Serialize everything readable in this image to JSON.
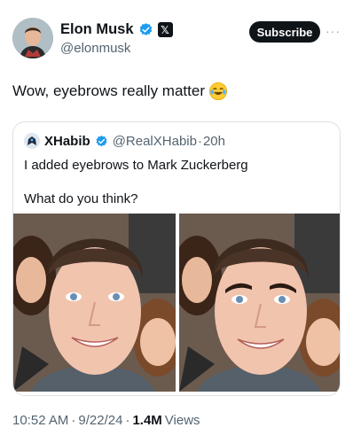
{
  "author": {
    "name": "Elon Musk",
    "handle": "@elonmusk",
    "subscribe_label": "Subscribe",
    "more_label": "···"
  },
  "tweet": {
    "text": "Wow, eyebrows really matter",
    "emoji": "face-with-tears-of-joy"
  },
  "quote": {
    "name": "XHabib",
    "handle": "@RealXHabib",
    "separator": "·",
    "time": "20h",
    "line1": "I added eyebrows to Mark Zuckerberg",
    "line2": "What do you think?",
    "images": [
      "original-photo",
      "edited-photo-with-eyebrows"
    ]
  },
  "meta": {
    "time": "10:52 AM",
    "sep1": "·",
    "date": "9/22/24",
    "sep2": "·",
    "views_count": "1.4M",
    "views_label": "Views"
  },
  "colors": {
    "text": "#0f1419",
    "secondary": "#536471",
    "verified": "#1d9bf0",
    "border": "#dbe1e6"
  }
}
